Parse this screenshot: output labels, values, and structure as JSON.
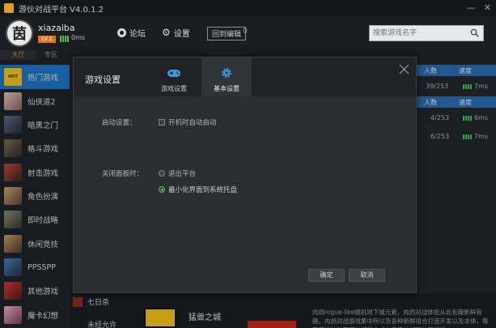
{
  "app": {
    "title": "游伙对战平台 V4.0.1.2"
  },
  "window": {
    "minimize": "—",
    "close": "✕"
  },
  "user": {
    "avatar_char": "茵",
    "name": "xiazaiba",
    "level": "LV.1",
    "ping": "0ms"
  },
  "header": {
    "forum_label": "论坛",
    "settings_label": "设置",
    "return_label": "回到编辑",
    "count": "0",
    "search_placeholder": "搜索游戏名字"
  },
  "subtabs": {
    "tab1": "大厅",
    "tab2": "专区"
  },
  "sidebar": {
    "items": [
      {
        "label": "热门游戏",
        "thumb_text": "HOT"
      },
      {
        "label": "仙侠道2"
      },
      {
        "label": "暗黑之门"
      },
      {
        "label": "格斗游戏"
      },
      {
        "label": "射击游戏"
      },
      {
        "label": "角色扮演"
      },
      {
        "label": "即时战略"
      },
      {
        "label": "休闲竞技"
      },
      {
        "label": "PPSSPP"
      },
      {
        "label": "其他游戏"
      },
      {
        "label": "魔卡幻想"
      }
    ]
  },
  "list": {
    "head1": {
      "people": "人数",
      "speed": "速度"
    },
    "head2": {
      "people": "人数",
      "speed": "速度"
    },
    "rows": [
      {
        "people": "39/253",
        "ms": "7ms"
      },
      {
        "people": "4/253",
        "ms": "6ms"
      },
      {
        "people": "6/253",
        "ms": "7ms"
      }
    ]
  },
  "bottom": {
    "day7": "七日杀",
    "unk": "未经允许",
    "game_title": "猛兽之城",
    "desc": "肉鸽rogue-like随机地下城元素，肉鸽对战体验从此有趣新鲜有趣。肉鸽对战游戏集中所以及各种新鲜组合打造开发以及本体，每天都能体验不同的游戏方式上手简单好玩的新游戏"
  },
  "modal": {
    "title": "游戏设置",
    "tabs": [
      {
        "label": "游戏设置",
        "icon": "gamepad-icon"
      },
      {
        "label": "基本设置",
        "icon": "gear-icon"
      }
    ],
    "startup_label": "启动设置：",
    "startup_option": "开机时自动启动",
    "close_label": "关闭面板时：",
    "close_opt1": "退出平台",
    "close_opt2": "最小化界面到系统托盘",
    "ok": "确定",
    "cancel": "取消"
  },
  "colors": {
    "accent": "#1f73c2",
    "ok_green": "#3ec84a",
    "level_orange": "#e0731c"
  }
}
